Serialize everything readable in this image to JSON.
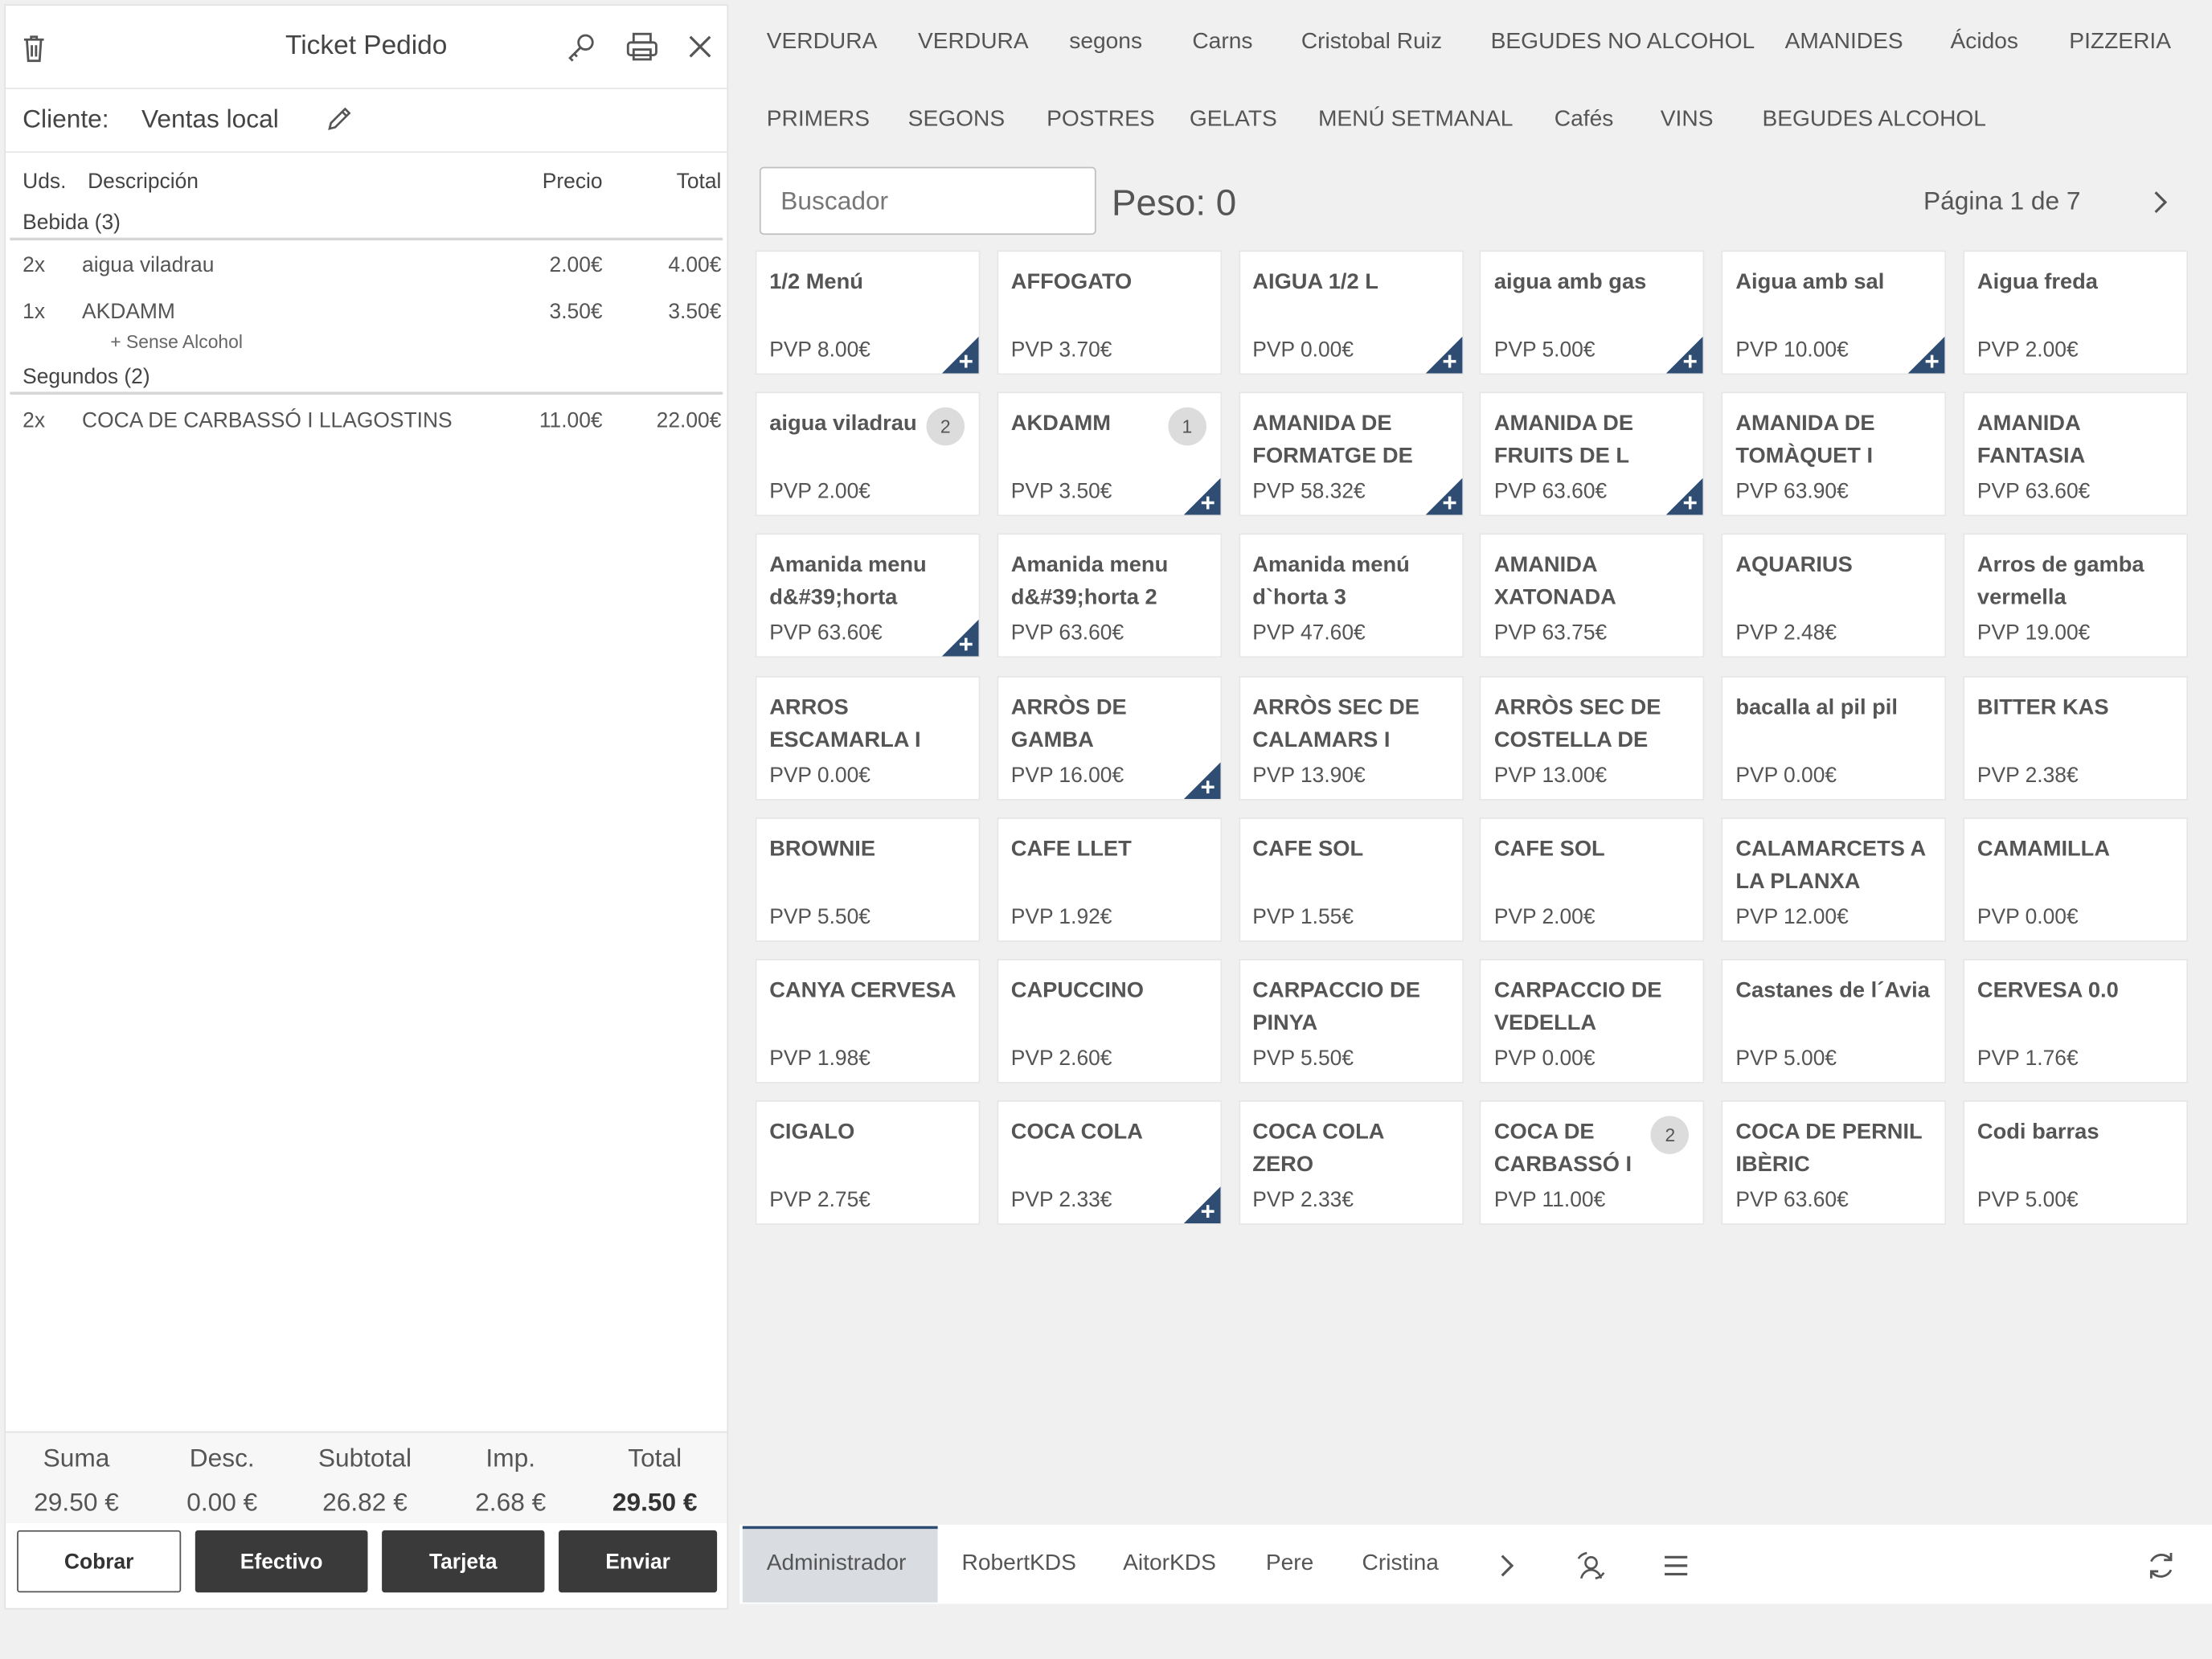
{
  "ticket": {
    "title": "Ticket Pedido",
    "client_label": "Cliente:",
    "client_value": "Ventas local",
    "columns": {
      "units": "Uds.",
      "description": "Descripción",
      "price": "Precio",
      "total": "Total"
    },
    "groups": [
      {
        "name": "Bebida (3)",
        "lines": [
          {
            "qty": "2x",
            "desc": "aigua viladrau",
            "price": "2.00€",
            "total": "4.00€"
          },
          {
            "qty": "1x",
            "desc": "AKDAMM",
            "price": "3.50€",
            "total": "3.50€",
            "modifier": "+ Sense Alcohol"
          }
        ]
      },
      {
        "name": "Segundos (2)",
        "lines": [
          {
            "qty": "2x",
            "desc": "COCA DE CARBASSÓ I LLAGOSTINS",
            "price": "11.00€",
            "total": "22.00€"
          }
        ]
      }
    ],
    "totals": {
      "suma_label": "Suma",
      "suma": "29.50 €",
      "desc_label": "Desc.",
      "desc": "0.00 €",
      "subtotal_label": "Subtotal",
      "subtotal": "26.82 €",
      "imp_label": "Imp.",
      "imp": "2.68 €",
      "total_label": "Total",
      "total": "29.50 €"
    },
    "buttons": {
      "cobrar": "Cobrar",
      "efectivo": "Efectivo",
      "tarjeta": "Tarjeta",
      "enviar": "Enviar"
    }
  },
  "categories_row1": [
    "VERDURA",
    "VERDURA",
    "segons",
    "Carns",
    "Cristobal Ruiz",
    "BEGUDES NO ALCOHOL",
    "AMANIDES",
    "Ácidos",
    "PIZZERIA"
  ],
  "categories_row2": [
    "PRIMERS",
    "SEGONS",
    "POSTRES",
    "GELATS",
    "MENÚ SETMANAL",
    "Cafés",
    "VINS",
    "BEGUDES ALCOHOL"
  ],
  "search": {
    "placeholder": "Buscador"
  },
  "peso": "Peso: 0",
  "pagination": "Página 1 de 7",
  "products": [
    {
      "name": "1/2 Menú",
      "price": "PVP 8.00€",
      "plus": true
    },
    {
      "name": "AFFOGATO",
      "price": "PVP 3.70€"
    },
    {
      "name": "AIGUA 1/2 L",
      "price": "PVP 0.00€",
      "plus": true
    },
    {
      "name": "aigua amb gas",
      "price": "PVP 5.00€",
      "plus": true
    },
    {
      "name": "Aigua amb sal",
      "price": "PVP 10.00€",
      "plus": true
    },
    {
      "name": "Aigua freda",
      "price": "PVP 2.00€"
    },
    {
      "name": "aigua viladrau",
      "price": "PVP 2.00€",
      "badge": "2"
    },
    {
      "name": "AKDAMM",
      "price": "PVP 3.50€",
      "badge": "1",
      "plus": true
    },
    {
      "name": "AMANIDA DE FORMATGE DE",
      "price": "PVP 58.32€",
      "plus": true
    },
    {
      "name": "AMANIDA DE FRUITS DE L",
      "price": "PVP 63.60€",
      "plus": true
    },
    {
      "name": "AMANIDA DE TOMÀQUET I",
      "price": "PVP 63.90€"
    },
    {
      "name": "AMANIDA FANTASIA",
      "price": "PVP 63.60€"
    },
    {
      "name": "Amanida menu d&#39;horta",
      "price": "PVP 63.60€",
      "plus": true
    },
    {
      "name": "Amanida menu d&#39;horta 2",
      "price": "PVP 63.60€"
    },
    {
      "name": "Amanida menú d`horta 3",
      "price": "PVP 47.60€"
    },
    {
      "name": "AMANIDA XATONADA",
      "price": "PVP 63.75€"
    },
    {
      "name": "AQUARIUS",
      "price": "PVP 2.48€"
    },
    {
      "name": "Arros de gamba vermella",
      "price": "PVP 19.00€"
    },
    {
      "name": "ARROS ESCAMARLA I PEU",
      "price": "PVP 0.00€"
    },
    {
      "name": "ARRÒS DE GAMBA",
      "price": "PVP 16.00€",
      "plus": true
    },
    {
      "name": "ARRÒS SEC DE CALAMARS I",
      "price": "PVP 13.90€"
    },
    {
      "name": "ARRÒS SEC DE COSTELLA DE",
      "price": "PVP 13.00€"
    },
    {
      "name": "bacalla al pil pil",
      "price": "PVP 0.00€"
    },
    {
      "name": "BITTER KAS",
      "price": "PVP 2.38€"
    },
    {
      "name": "BROWNIE",
      "price": "PVP 5.50€"
    },
    {
      "name": "CAFE LLET",
      "price": "PVP 1.92€"
    },
    {
      "name": "CAFE SOL",
      "price": "PVP 1.55€"
    },
    {
      "name": "CAFE SOL",
      "price": "PVP 2.00€"
    },
    {
      "name": "CALAMARCETS A LA PLANXA",
      "price": "PVP 12.00€"
    },
    {
      "name": "CAMAMILLA",
      "price": "PVP 0.00€"
    },
    {
      "name": "CANYA CERVESA",
      "price": "PVP 1.98€"
    },
    {
      "name": "CAPUCCINO",
      "price": "PVP 2.60€"
    },
    {
      "name": "CARPACCIO DE PINYA",
      "price": "PVP 5.50€"
    },
    {
      "name": "CARPACCIO DE VEDELLA",
      "price": "PVP 0.00€"
    },
    {
      "name": "Castanes de l´Avia",
      "price": "PVP 5.00€"
    },
    {
      "name": "CERVESA 0.0",
      "price": "PVP 1.76€"
    },
    {
      "name": "CIGALO",
      "price": "PVP 2.75€"
    },
    {
      "name": "COCA COLA",
      "price": "PVP 2.33€",
      "plus": true
    },
    {
      "name": "COCA COLA ZERO",
      "price": "PVP 2.33€"
    },
    {
      "name": "COCA DE CARBASSÓ I",
      "price": "PVP 11.00€",
      "badge": "2"
    },
    {
      "name": "COCA DE PERNIL IBÈRIC",
      "price": "PVP 63.60€"
    },
    {
      "name": "Codi barras",
      "price": "PVP 5.00€"
    }
  ],
  "users": [
    "Administrador",
    "RobertKDS",
    "AitorKDS",
    "Pere",
    "Cristina"
  ],
  "colors": {
    "accent": "#2f4d73",
    "dark_button": "#3a3a3a",
    "badge": "#dcdcdc"
  },
  "icons": [
    "trash-icon",
    "key-icon",
    "printer-icon",
    "close-icon",
    "pencil-icon",
    "chevron-right-icon",
    "user-switch-icon",
    "menu-icon",
    "refresh-icon",
    "plus-corner-icon"
  ]
}
